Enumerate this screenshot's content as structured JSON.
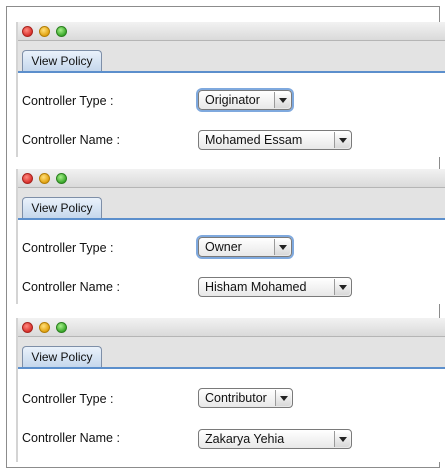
{
  "windows": [
    {
      "tab_label": "View Policy",
      "controller_type_label": "Controller Type :",
      "controller_type_value": "Originator",
      "controller_name_label": "Controller Name :",
      "controller_name_value": "Mohamed Essam"
    },
    {
      "tab_label": "View Policy",
      "controller_type_label": "Controller Type :",
      "controller_type_value": "Owner",
      "controller_name_label": "Controller Name :",
      "controller_name_value": "Hisham Mohamed"
    },
    {
      "tab_label": "View Policy",
      "controller_type_label": "Controller Type :",
      "controller_type_value": "Contributor",
      "controller_name_label": "Controller Name :",
      "controller_name_value": "Zakarya Yehia"
    }
  ],
  "icons": {
    "close": "red-close-icon",
    "minimize": "yellow-minimize-icon",
    "zoom": "green-zoom-icon",
    "dropdown": "chevron-down-icon"
  },
  "colors": {
    "tab_underline": "#5c8fcc",
    "focus_ring": "#7fa9de"
  }
}
